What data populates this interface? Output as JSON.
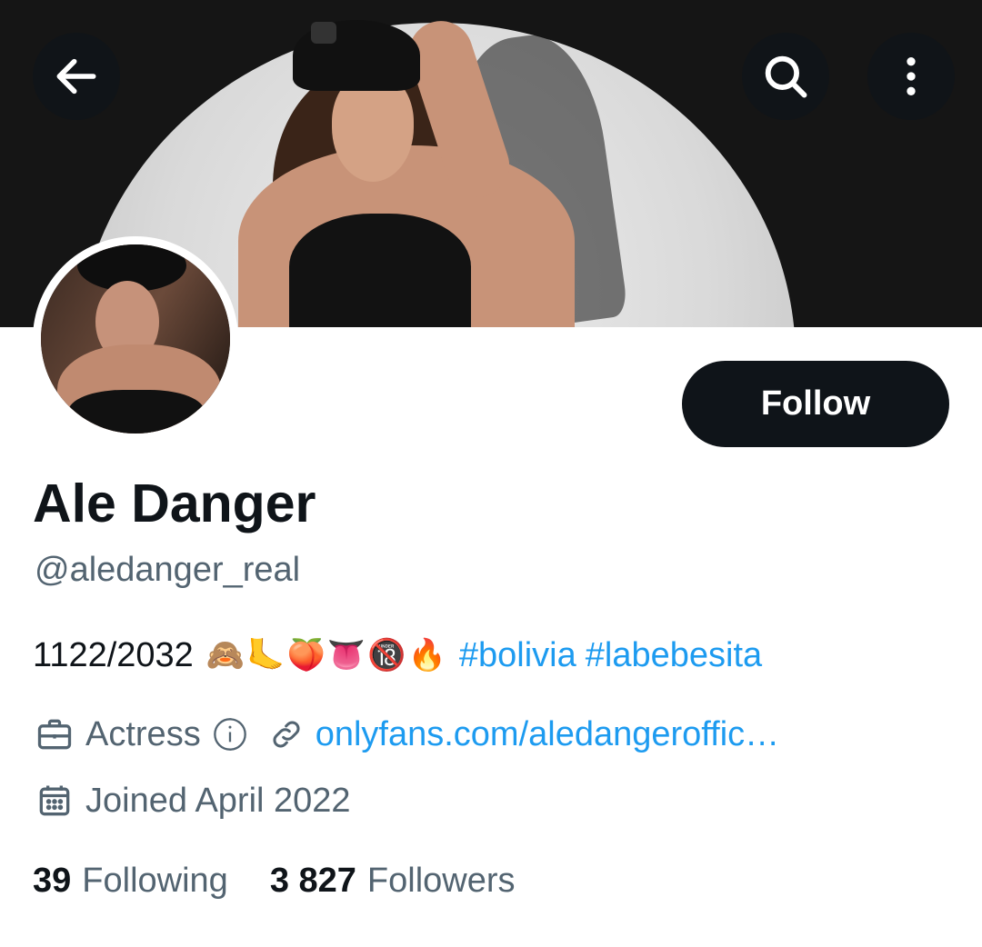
{
  "header": {
    "back_icon": "arrow-left-icon",
    "search_icon": "search-icon",
    "more_icon": "more-vertical-icon"
  },
  "profile": {
    "name": "Ale Danger",
    "handle": "@aledanger_real",
    "follow_label": "Follow",
    "bio": {
      "text": "1122/2032",
      "emojis": [
        "🙈",
        "🦶",
        "🍑",
        "👅",
        "🔞",
        "🔥"
      ],
      "hashtags": [
        "#bolivia",
        "#labebesita"
      ]
    },
    "category": "Actress",
    "website": "onlyfans.com/aledangeroffic…",
    "joined": "Joined April 2022"
  },
  "stats": {
    "following_count": "39",
    "following_label": "Following",
    "followers_count": "3 827",
    "followers_label": "Followers"
  },
  "colors": {
    "accent": "#1d9bf0",
    "text_primary": "#0f1419",
    "text_secondary": "#536471",
    "button_bg": "#0f1419"
  }
}
